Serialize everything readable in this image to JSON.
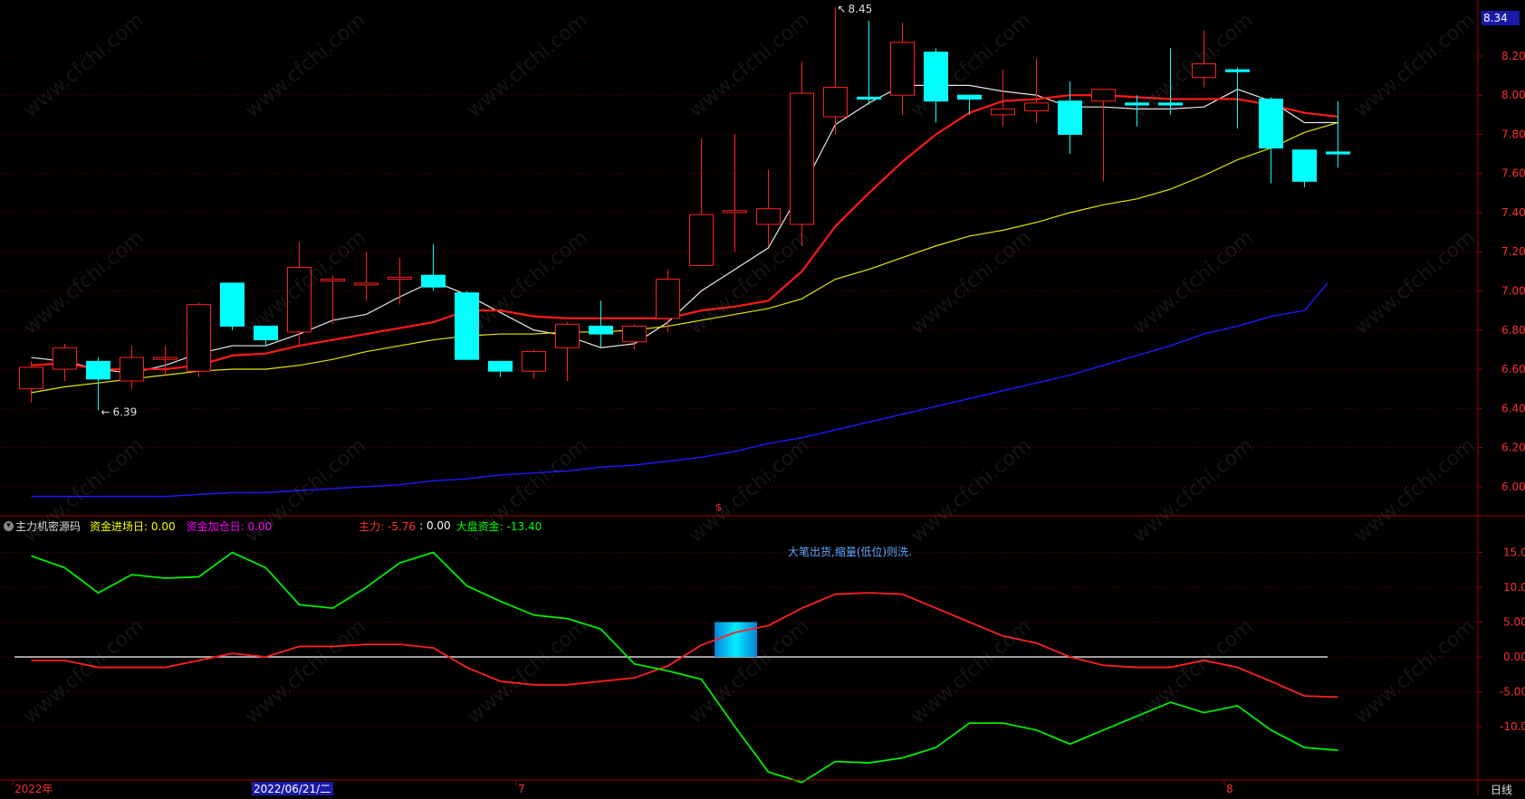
{
  "price_axis": {
    "ticks": [
      "8.20",
      "8.00",
      "7.80",
      "7.60",
      "7.40",
      "7.20",
      "7.00",
      "6.80",
      "6.60",
      "6.40",
      "6.20",
      "6.00"
    ],
    "current_price_tag": "8.34",
    "max_label": "8.45",
    "min_label": "6.39"
  },
  "indicator_axis": {
    "ticks": [
      "15.00",
      "10.00",
      "5.00",
      "0.00",
      "-5.00",
      "-10.00"
    ]
  },
  "indicator_header": {
    "name": "主力机密源码",
    "items": [
      {
        "label": "资金进场日: 0.00",
        "color": "#ffff00"
      },
      {
        "label": "资金加仓日: 0.00",
        "color": "#ff00ff"
      },
      {
        "label": "主力: -5.76",
        "color": "#ff3030"
      },
      {
        "label": ": 0.00",
        "color": "#ffffff"
      },
      {
        "label": "大盘资金: -13.40",
        "color": "#00ff00"
      }
    ]
  },
  "signal_note": "大笔出货,缩量(低位)则洗.",
  "time_axis": {
    "labels": [
      "2022年",
      "2022/06/21/二",
      "7",
      "8"
    ],
    "period": "日线"
  },
  "watermark_text": "www.cfchi.com",
  "colors": {
    "up": "#ff2020",
    "down": "#00ffff",
    "ma5": "#e8e8e8",
    "ma10": "#ff1a1a",
    "ma20": "#e8e800",
    "ma60": "#1a1aff",
    "grid": "#6a0000",
    "axis": "#a00000"
  },
  "chart_data": [
    {
      "type": "candlestick",
      "ylim": [
        5.9,
        8.5
      ],
      "candles": [
        {
          "o": 6.5,
          "h": 6.64,
          "l": 6.43,
          "c": 6.61
        },
        {
          "o": 6.6,
          "h": 6.73,
          "l": 6.54,
          "c": 6.71
        },
        {
          "o": 6.64,
          "h": 6.66,
          "l": 6.39,
          "c": 6.55
        },
        {
          "o": 6.54,
          "h": 6.72,
          "l": 6.5,
          "c": 6.66
        },
        {
          "o": 6.65,
          "h": 6.72,
          "l": 6.57,
          "c": 6.66
        },
        {
          "o": 6.59,
          "h": 6.94,
          "l": 6.56,
          "c": 6.93
        },
        {
          "o": 7.04,
          "h": 7.04,
          "l": 6.8,
          "c": 6.82
        },
        {
          "o": 6.82,
          "h": 6.82,
          "l": 6.72,
          "c": 6.75
        },
        {
          "o": 6.79,
          "h": 7.25,
          "l": 6.72,
          "c": 7.12
        },
        {
          "o": 7.06,
          "h": 7.08,
          "l": 6.83,
          "c": 7.06
        },
        {
          "o": 7.04,
          "h": 7.2,
          "l": 6.95,
          "c": 7.04
        },
        {
          "o": 7.06,
          "h": 7.17,
          "l": 6.93,
          "c": 7.07
        },
        {
          "o": 7.08,
          "h": 7.24,
          "l": 7.0,
          "c": 7.02
        },
        {
          "o": 6.99,
          "h": 7.0,
          "l": 6.65,
          "c": 6.65
        },
        {
          "o": 6.64,
          "h": 6.64,
          "l": 6.56,
          "c": 6.59
        },
        {
          "o": 6.59,
          "h": 6.7,
          "l": 6.55,
          "c": 6.69
        },
        {
          "o": 6.71,
          "h": 6.84,
          "l": 6.54,
          "c": 6.83
        },
        {
          "o": 6.82,
          "h": 6.95,
          "l": 6.71,
          "c": 6.78
        },
        {
          "o": 6.74,
          "h": 6.83,
          "l": 6.7,
          "c": 6.82
        },
        {
          "o": 6.86,
          "h": 7.11,
          "l": 6.79,
          "c": 7.06
        },
        {
          "o": 7.13,
          "h": 7.78,
          "l": 7.13,
          "c": 7.39
        },
        {
          "o": 7.4,
          "h": 7.8,
          "l": 7.2,
          "c": 7.41
        },
        {
          "o": 7.34,
          "h": 7.62,
          "l": 7.23,
          "c": 7.42
        },
        {
          "o": 7.34,
          "h": 8.17,
          "l": 7.23,
          "c": 8.01
        },
        {
          "o": 7.89,
          "h": 8.45,
          "l": 7.8,
          "c": 8.04
        },
        {
          "o": 7.99,
          "h": 8.38,
          "l": 7.95,
          "c": 7.98
        },
        {
          "o": 8.0,
          "h": 8.37,
          "l": 7.9,
          "c": 8.27
        },
        {
          "o": 8.22,
          "h": 8.24,
          "l": 7.86,
          "c": 7.97
        },
        {
          "o": 8.0,
          "h": 8.0,
          "l": 7.9,
          "c": 7.98
        },
        {
          "o": 7.9,
          "h": 8.13,
          "l": 7.84,
          "c": 7.93
        },
        {
          "o": 7.92,
          "h": 8.19,
          "l": 7.86,
          "c": 7.96
        },
        {
          "o": 7.97,
          "h": 8.07,
          "l": 7.7,
          "c": 7.8
        },
        {
          "o": 7.97,
          "h": 8.03,
          "l": 7.56,
          "c": 8.03
        },
        {
          "o": 7.96,
          "h": 8.0,
          "l": 7.84,
          "c": 7.95
        },
        {
          "o": 7.96,
          "h": 8.24,
          "l": 7.9,
          "c": 7.95
        },
        {
          "o": 8.09,
          "h": 8.33,
          "l": 8.04,
          "c": 8.16
        },
        {
          "o": 8.13,
          "h": 8.14,
          "l": 7.83,
          "c": 8.12
        },
        {
          "o": 7.98,
          "h": 7.99,
          "l": 7.55,
          "c": 7.73
        },
        {
          "o": 7.72,
          "h": 7.72,
          "l": 7.53,
          "c": 7.56
        },
        {
          "o": 7.71,
          "h": 7.97,
          "l": 7.63,
          "c": 7.7
        }
      ],
      "series": [
        {
          "name": "MA5",
          "values": [
            6.66,
            6.64,
            6.6,
            6.58,
            6.62,
            6.68,
            6.72,
            6.72,
            6.78,
            6.85,
            6.88,
            6.97,
            7.05,
            6.98,
            6.89,
            6.8,
            6.77,
            6.71,
            6.73,
            6.84,
            7.0,
            7.11,
            7.22,
            7.52,
            7.85,
            7.96,
            8.05,
            8.05,
            8.05,
            8.02,
            8.0,
            7.94,
            7.94,
            7.93,
            7.93,
            7.94,
            8.03,
            7.97,
            7.86,
            7.86
          ]
        },
        {
          "name": "MA10",
          "values": [
            6.62,
            6.63,
            6.6,
            6.6,
            6.6,
            6.62,
            6.67,
            6.68,
            6.72,
            6.75,
            6.78,
            6.81,
            6.84,
            6.9,
            6.9,
            6.87,
            6.86,
            6.86,
            6.86,
            6.86,
            6.9,
            6.92,
            6.95,
            7.1,
            7.33,
            7.5,
            7.66,
            7.8,
            7.91,
            7.97,
            7.98,
            8.0,
            8.0,
            7.99,
            7.98,
            7.98,
            7.98,
            7.95,
            7.91,
            7.89
          ]
        },
        {
          "name": "MA20",
          "values": [
            6.48,
            6.51,
            6.53,
            6.55,
            6.57,
            6.59,
            6.6,
            6.6,
            6.62,
            6.65,
            6.69,
            6.72,
            6.75,
            6.77,
            6.78,
            6.78,
            6.79,
            6.79,
            6.8,
            6.82,
            6.85,
            6.88,
            6.91,
            6.96,
            7.06,
            7.11,
            7.17,
            7.23,
            7.28,
            7.31,
            7.35,
            7.4,
            7.44,
            7.47,
            7.52,
            7.59,
            7.67,
            7.73,
            7.81,
            7.86
          ]
        },
        {
          "name": "MA60",
          "values": [
            5.95,
            5.95,
            5.95,
            5.95,
            5.95,
            5.96,
            5.97,
            5.97,
            5.98,
            5.99,
            6.0,
            6.01,
            6.03,
            6.04,
            6.06,
            6.07,
            6.08,
            6.1,
            6.11,
            6.13,
            6.15,
            6.18,
            6.22,
            6.25,
            6.29,
            6.33,
            6.37,
            6.41,
            6.45,
            6.49,
            6.53,
            6.57,
            6.62,
            6.67,
            6.72,
            6.78,
            6.82,
            6.87,
            6.9,
            7.04
          ]
        }
      ]
    },
    {
      "type": "line",
      "ylim": [
        -18,
        19
      ],
      "series": [
        {
          "name": "主力",
          "values": [
            -0.5,
            -0.5,
            -1.5,
            -1.5,
            -1.5,
            -0.5,
            0.5,
            0.0,
            1.5,
            1.5,
            1.8,
            1.8,
            1.3,
            -1.5,
            -3.5,
            -4.0,
            -4.0,
            -3.5,
            -3.0,
            -1.3,
            1.7,
            3.5,
            4.5,
            7.0,
            9.0,
            9.2,
            9.0,
            7.0,
            5.0,
            3.0,
            2.0,
            0.0,
            -1.2,
            -1.5,
            -1.5,
            -0.5,
            -1.5,
            -3.5,
            -5.6,
            -5.76
          ]
        },
        {
          "name": "大盘资金",
          "values": [
            14.5,
            12.8,
            9.2,
            11.8,
            11.3,
            11.5,
            15.0,
            12.8,
            7.5,
            7.0,
            10.0,
            13.5,
            15.0,
            10.2,
            8.0,
            6.0,
            5.5,
            4.0,
            -1.0,
            -2.0,
            -3.2,
            -10.0,
            -16.5,
            -18.0,
            -15.0,
            -15.2,
            -14.5,
            -13.0,
            -9.5,
            -9.5,
            -10.5,
            -12.5,
            -10.5,
            -8.5,
            -6.5,
            -8.0,
            -7.0,
            -10.5,
            -13.0,
            -13.4
          ]
        },
        {
          "name": "zero",
          "values": [
            0
          ]
        }
      ],
      "signal_bar": {
        "index": 21,
        "from": 0.0,
        "to": 5.0
      }
    }
  ]
}
